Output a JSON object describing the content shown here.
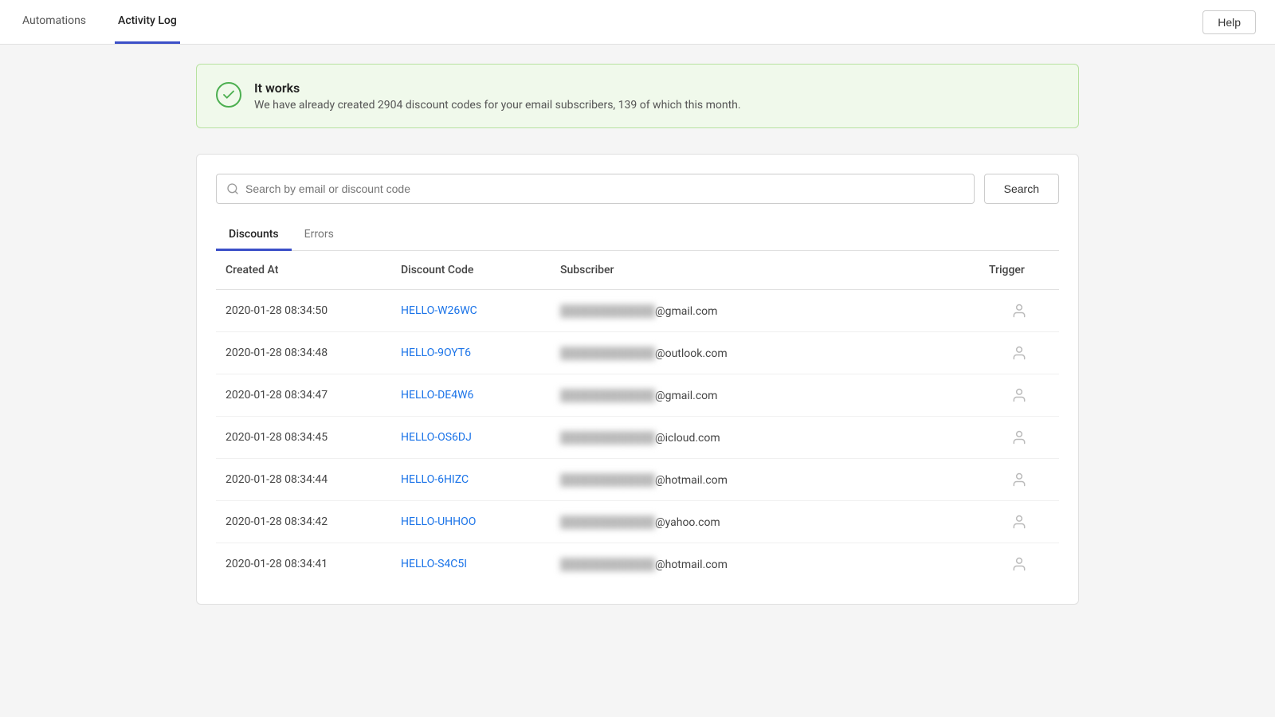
{
  "nav": {
    "tabs": [
      {
        "id": "automations",
        "label": "Automations",
        "active": false
      },
      {
        "id": "activity-log",
        "label": "Activity Log",
        "active": true
      }
    ],
    "help_button": "Help"
  },
  "banner": {
    "title": "It works",
    "text": "We have already created 2904 discount codes for your email subscribers, 139 of which this month."
  },
  "search": {
    "placeholder": "Search by email or discount code",
    "button_label": "Search"
  },
  "tabs": [
    {
      "id": "discounts",
      "label": "Discounts",
      "active": true
    },
    {
      "id": "errors",
      "label": "Errors",
      "active": false
    }
  ],
  "table": {
    "headers": {
      "created_at": "Created At",
      "discount_code": "Discount Code",
      "subscriber": "Subscriber",
      "trigger": "Trigger"
    },
    "rows": [
      {
        "created_at": "2020-01-28 08:34:50",
        "discount_code": "HELLO-W26WC",
        "subscriber_blurred": "████████████",
        "subscriber_domain": "@gmail.com",
        "trigger": "person"
      },
      {
        "created_at": "2020-01-28 08:34:48",
        "discount_code": "HELLO-9OYT6",
        "subscriber_blurred": "████████████",
        "subscriber_domain": "@outlook.com",
        "trigger": "person"
      },
      {
        "created_at": "2020-01-28 08:34:47",
        "discount_code": "HELLO-DE4W6",
        "subscriber_blurred": "████████████",
        "subscriber_domain": "@gmail.com",
        "trigger": "person"
      },
      {
        "created_at": "2020-01-28 08:34:45",
        "discount_code": "HELLO-OS6DJ",
        "subscriber_blurred": "████████████",
        "subscriber_domain": "@icloud.com",
        "trigger": "person"
      },
      {
        "created_at": "2020-01-28 08:34:44",
        "discount_code": "HELLO-6HIZC",
        "subscriber_blurred": "████████████",
        "subscriber_domain": "@hotmail.com",
        "trigger": "person"
      },
      {
        "created_at": "2020-01-28 08:34:42",
        "discount_code": "HELLO-UHHOO",
        "subscriber_blurred": "████████████",
        "subscriber_domain": "@yahoo.com",
        "trigger": "person"
      },
      {
        "created_at": "2020-01-28 08:34:41",
        "discount_code": "HELLO-S4C5I",
        "subscriber_blurred": "████████████",
        "subscriber_domain": "@hotmail.com",
        "trigger": "person"
      }
    ]
  }
}
